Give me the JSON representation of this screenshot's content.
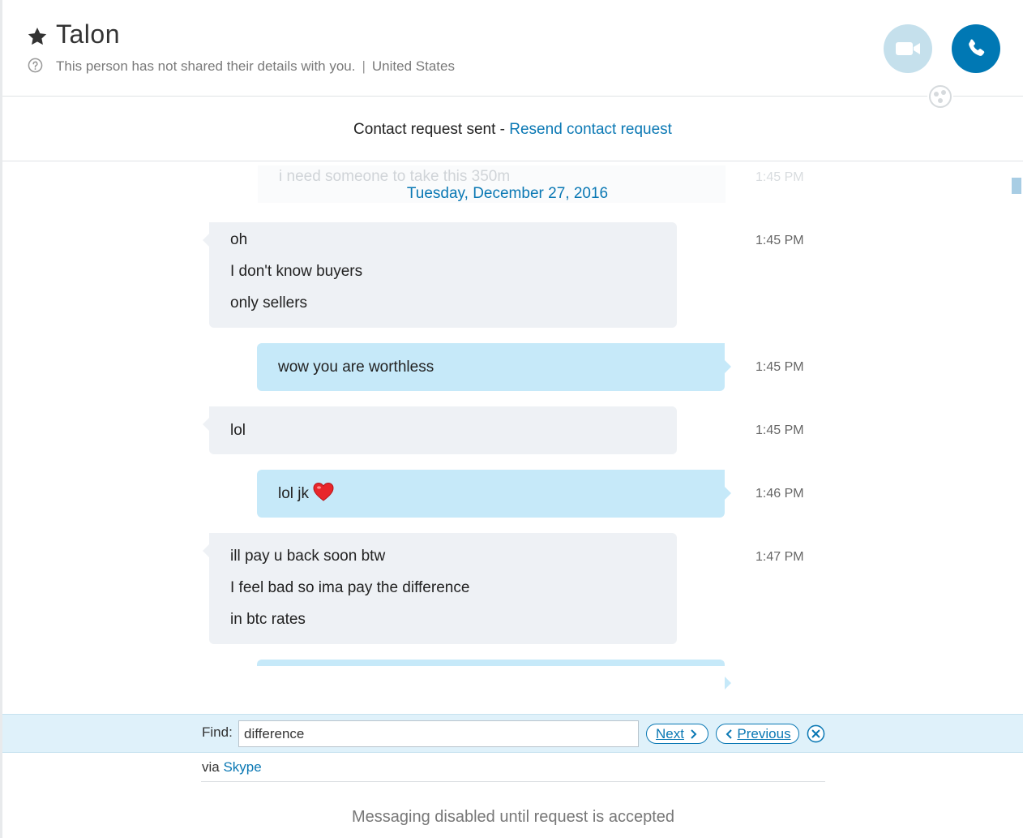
{
  "header": {
    "contact_name": "Talon",
    "details_text": "This person has not shared their details with you.",
    "separator": "|",
    "location": "United States"
  },
  "request_bar": {
    "status_text": "Contact request sent - ",
    "resend_link": "Resend contact request"
  },
  "chat": {
    "faded_message": {
      "text": "i need someone to take this 350m",
      "time": "1:45 PM"
    },
    "date_label": "Tuesday, December 27, 2016",
    "messages": [
      {
        "direction": "in",
        "lines": [
          "oh",
          "I don't know buyers",
          "only sellers"
        ],
        "time": "1:45 PM"
      },
      {
        "direction": "out",
        "lines": [
          "wow you are worthless"
        ],
        "time": "1:45 PM"
      },
      {
        "direction": "in",
        "lines": [
          "lol"
        ],
        "time": "1:45 PM"
      },
      {
        "direction": "out",
        "lines": [
          "lol jk"
        ],
        "emoji": "heart-icon",
        "time": "1:46 PM"
      },
      {
        "direction": "in",
        "lines": [
          "ill pay u back soon btw",
          "I feel bad so ima pay the difference",
          "in btc rates"
        ],
        "time": "1:47 PM"
      }
    ]
  },
  "find_bar": {
    "label": "Find:",
    "value": "difference",
    "next_label": "Next",
    "previous_label": "Previous"
  },
  "footer": {
    "via_text": "via",
    "via_link": "Skype",
    "disabled_text": "Messaging disabled until request is accepted"
  },
  "colors": {
    "accent": "#0a78b4",
    "call_button": "#0078b4",
    "video_button": "#c5e0ec",
    "incoming_bubble": "#eef1f5",
    "outgoing_bubble": "#c6e9f9",
    "find_bar": "#dff1fa"
  }
}
